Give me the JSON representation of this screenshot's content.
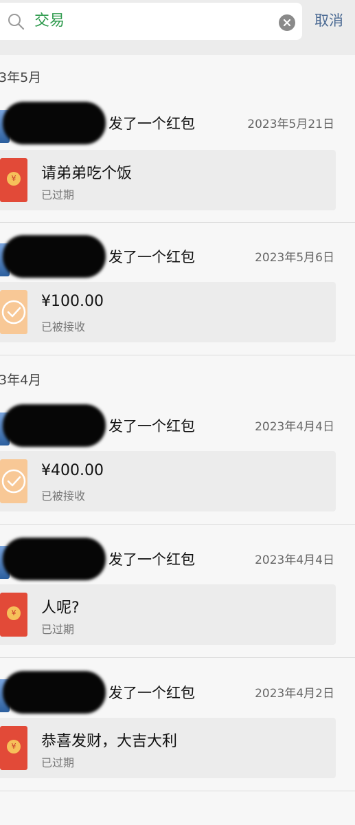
{
  "search": {
    "query": "交易",
    "cancel_label": "取消"
  },
  "months": [
    "3年5月",
    "3年4月"
  ],
  "records": [
    {
      "title": "发了一个红包",
      "date": "2023年5月21日",
      "card_title": "请弟弟吃个饭",
      "card_status": "已过期",
      "icon": "red-packet-icon"
    },
    {
      "title": "发了一个红包",
      "date": "2023年5月6日",
      "card_title": "¥100.00",
      "card_status": "已被接收",
      "icon": "received-check-icon"
    },
    {
      "title": "发了一个红包",
      "date": "2023年4月4日",
      "card_title": "¥400.00",
      "card_status": "已被接收",
      "icon": "received-check-icon"
    },
    {
      "title": "发了一个红包",
      "date": "2023年4月4日",
      "card_title": "人呢?",
      "card_status": "已过期",
      "icon": "red-packet-icon"
    },
    {
      "title": "发了一个红包",
      "date": "2023年4月2日",
      "card_title": "恭喜发财，大吉大利",
      "card_status": "已过期",
      "icon": "red-packet-icon"
    }
  ],
  "colors": {
    "red_packet": "#e24a38",
    "received": "#f8c896",
    "search_text": "#2e9a4d",
    "cancel": "#4b6a93"
  }
}
